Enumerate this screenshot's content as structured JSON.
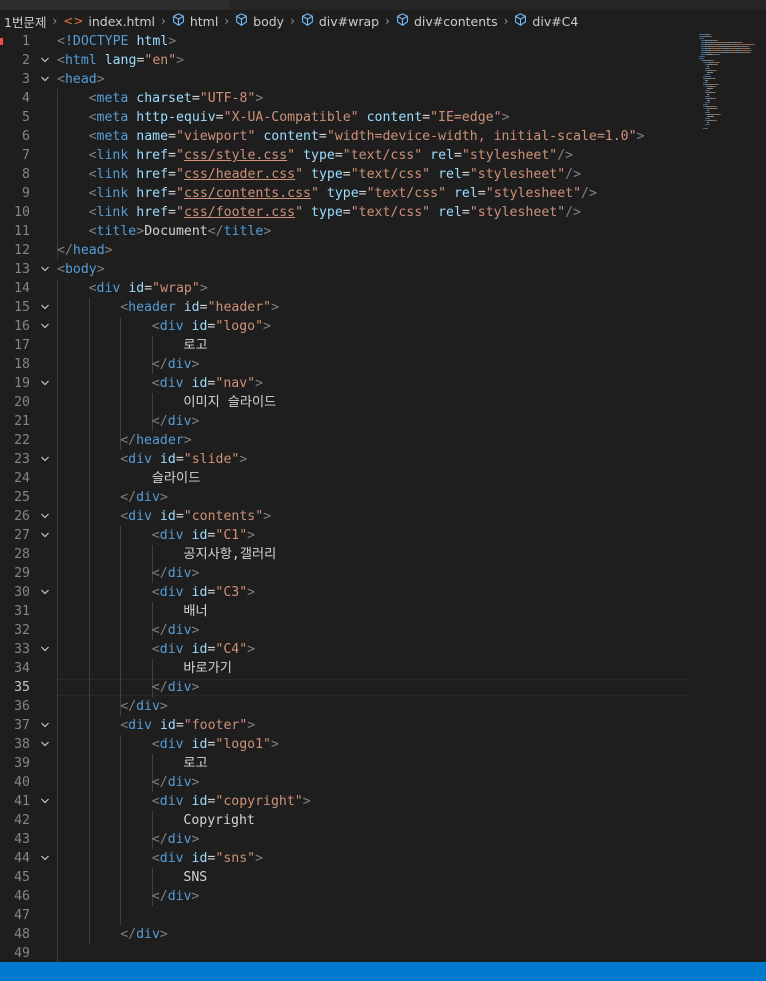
{
  "breadcrumb": [
    {
      "label": "1번문제",
      "icon": ""
    },
    {
      "label": "index.html",
      "icon": "html-file-icon"
    },
    {
      "label": "html",
      "icon": "element-cube-icon"
    },
    {
      "label": "body",
      "icon": "element-cube-icon"
    },
    {
      "label": "div#wrap",
      "icon": "element-cube-icon"
    },
    {
      "label": "div#contents",
      "icon": "element-cube-icon"
    },
    {
      "label": "div#C4",
      "icon": "element-cube-icon"
    }
  ],
  "active_line": 35,
  "colors": {
    "tag": "#569cd6",
    "attr": "#9cdcfe",
    "string": "#ce9178",
    "punct": "#808080",
    "text": "#d4d4d4",
    "status_bar": "#007acc"
  },
  "lines": [
    {
      "n": 1,
      "indent": 0,
      "fold": false,
      "tokens": [
        [
          "p",
          "<"
        ],
        [
          "t",
          "!DOCTYPE"
        ],
        [
          "x",
          " "
        ],
        [
          "a",
          "html"
        ],
        [
          "p",
          ">"
        ]
      ]
    },
    {
      "n": 2,
      "indent": 0,
      "fold": true,
      "tokens": [
        [
          "p",
          "<"
        ],
        [
          "t",
          "html"
        ],
        [
          "x",
          " "
        ],
        [
          "a",
          "lang"
        ],
        [
          "x",
          "="
        ],
        [
          "s",
          "\"en\""
        ],
        [
          "p",
          ">"
        ]
      ]
    },
    {
      "n": 3,
      "indent": 0,
      "fold": true,
      "tokens": [
        [
          "p",
          "<"
        ],
        [
          "t",
          "head"
        ],
        [
          "p",
          ">"
        ]
      ]
    },
    {
      "n": 4,
      "indent": 1,
      "fold": false,
      "tokens": [
        [
          "p",
          "<"
        ],
        [
          "t",
          "meta"
        ],
        [
          "x",
          " "
        ],
        [
          "a",
          "charset"
        ],
        [
          "x",
          "="
        ],
        [
          "s",
          "\"UTF-8\""
        ],
        [
          "p",
          ">"
        ]
      ]
    },
    {
      "n": 5,
      "indent": 1,
      "fold": false,
      "tokens": [
        [
          "p",
          "<"
        ],
        [
          "t",
          "meta"
        ],
        [
          "x",
          " "
        ],
        [
          "a",
          "http-equiv"
        ],
        [
          "x",
          "="
        ],
        [
          "s",
          "\"X-UA-Compatible\""
        ],
        [
          "x",
          " "
        ],
        [
          "a",
          "content"
        ],
        [
          "x",
          "="
        ],
        [
          "s",
          "\"IE=edge\""
        ],
        [
          "p",
          ">"
        ]
      ]
    },
    {
      "n": 6,
      "indent": 1,
      "fold": false,
      "tokens": [
        [
          "p",
          "<"
        ],
        [
          "t",
          "meta"
        ],
        [
          "x",
          " "
        ],
        [
          "a",
          "name"
        ],
        [
          "x",
          "="
        ],
        [
          "s",
          "\"viewport\""
        ],
        [
          "x",
          " "
        ],
        [
          "a",
          "content"
        ],
        [
          "x",
          "="
        ],
        [
          "s",
          "\"width=device-width, initial-scale=1.0\""
        ],
        [
          "p",
          ">"
        ]
      ]
    },
    {
      "n": 7,
      "indent": 1,
      "fold": false,
      "tokens": [
        [
          "p",
          "<"
        ],
        [
          "t",
          "link"
        ],
        [
          "x",
          " "
        ],
        [
          "a",
          "href"
        ],
        [
          "x",
          "="
        ],
        [
          "s",
          "\""
        ],
        [
          "su",
          "css/style.css"
        ],
        [
          "s",
          "\""
        ],
        [
          "x",
          " "
        ],
        [
          "a",
          "type"
        ],
        [
          "x",
          "="
        ],
        [
          "s",
          "\"text/css\""
        ],
        [
          "x",
          " "
        ],
        [
          "a",
          "rel"
        ],
        [
          "x",
          "="
        ],
        [
          "s",
          "\"stylesheet\""
        ],
        [
          "p",
          "/>"
        ]
      ]
    },
    {
      "n": 8,
      "indent": 1,
      "fold": false,
      "tokens": [
        [
          "p",
          "<"
        ],
        [
          "t",
          "link"
        ],
        [
          "x",
          " "
        ],
        [
          "a",
          "href"
        ],
        [
          "x",
          "="
        ],
        [
          "s",
          "\""
        ],
        [
          "su",
          "css/header.css"
        ],
        [
          "s",
          "\""
        ],
        [
          "x",
          " "
        ],
        [
          "a",
          "type"
        ],
        [
          "x",
          "="
        ],
        [
          "s",
          "\"text/css\""
        ],
        [
          "x",
          " "
        ],
        [
          "a",
          "rel"
        ],
        [
          "x",
          "="
        ],
        [
          "s",
          "\"stylesheet\""
        ],
        [
          "p",
          "/>"
        ]
      ]
    },
    {
      "n": 9,
      "indent": 1,
      "fold": false,
      "tokens": [
        [
          "p",
          "<"
        ],
        [
          "t",
          "link"
        ],
        [
          "x",
          " "
        ],
        [
          "a",
          "href"
        ],
        [
          "x",
          "="
        ],
        [
          "s",
          "\""
        ],
        [
          "su",
          "css/contents.css"
        ],
        [
          "s",
          "\""
        ],
        [
          "x",
          " "
        ],
        [
          "a",
          "type"
        ],
        [
          "x",
          "="
        ],
        [
          "s",
          "\"text/css\""
        ],
        [
          "x",
          " "
        ],
        [
          "a",
          "rel"
        ],
        [
          "x",
          "="
        ],
        [
          "s",
          "\"stylesheet\""
        ],
        [
          "p",
          "/>"
        ]
      ]
    },
    {
      "n": 10,
      "indent": 1,
      "fold": false,
      "tokens": [
        [
          "p",
          "<"
        ],
        [
          "t",
          "link"
        ],
        [
          "x",
          " "
        ],
        [
          "a",
          "href"
        ],
        [
          "x",
          "="
        ],
        [
          "s",
          "\""
        ],
        [
          "su",
          "css/footer.css"
        ],
        [
          "s",
          "\""
        ],
        [
          "x",
          " "
        ],
        [
          "a",
          "type"
        ],
        [
          "x",
          "="
        ],
        [
          "s",
          "\"text/css\""
        ],
        [
          "x",
          " "
        ],
        [
          "a",
          "rel"
        ],
        [
          "x",
          "="
        ],
        [
          "s",
          "\"stylesheet\""
        ],
        [
          "p",
          "/>"
        ]
      ]
    },
    {
      "n": 11,
      "indent": 1,
      "fold": false,
      "tokens": [
        [
          "p",
          "<"
        ],
        [
          "t",
          "title"
        ],
        [
          "p",
          ">"
        ],
        [
          "x",
          "Document"
        ],
        [
          "p",
          "</"
        ],
        [
          "t",
          "title"
        ],
        [
          "p",
          ">"
        ]
      ]
    },
    {
      "n": 12,
      "indent": 0,
      "fold": false,
      "tokens": [
        [
          "p",
          "</"
        ],
        [
          "t",
          "head"
        ],
        [
          "p",
          ">"
        ]
      ]
    },
    {
      "n": 13,
      "indent": 0,
      "fold": true,
      "tokens": [
        [
          "p",
          "<"
        ],
        [
          "t",
          "body"
        ],
        [
          "p",
          ">"
        ]
      ]
    },
    {
      "n": 14,
      "indent": 1,
      "fold": false,
      "tokens": [
        [
          "p",
          "<"
        ],
        [
          "t",
          "div"
        ],
        [
          "x",
          " "
        ],
        [
          "a",
          "id"
        ],
        [
          "x",
          "="
        ],
        [
          "s",
          "\"wrap\""
        ],
        [
          "p",
          ">"
        ]
      ]
    },
    {
      "n": 15,
      "indent": 2,
      "fold": true,
      "tokens": [
        [
          "p",
          "<"
        ],
        [
          "t",
          "header"
        ],
        [
          "x",
          " "
        ],
        [
          "a",
          "id"
        ],
        [
          "x",
          "="
        ],
        [
          "s",
          "\"header\""
        ],
        [
          "p",
          ">"
        ]
      ]
    },
    {
      "n": 16,
      "indent": 3,
      "fold": true,
      "tokens": [
        [
          "p",
          "<"
        ],
        [
          "t",
          "div"
        ],
        [
          "x",
          " "
        ],
        [
          "a",
          "id"
        ],
        [
          "x",
          "="
        ],
        [
          "s",
          "\"logo\""
        ],
        [
          "p",
          ">"
        ]
      ]
    },
    {
      "n": 17,
      "indent": 4,
      "fold": false,
      "tokens": [
        [
          "x",
          "로고"
        ]
      ]
    },
    {
      "n": 18,
      "indent": 3,
      "fold": false,
      "tokens": [
        [
          "p",
          "</"
        ],
        [
          "t",
          "div"
        ],
        [
          "p",
          ">"
        ]
      ]
    },
    {
      "n": 19,
      "indent": 3,
      "fold": true,
      "tokens": [
        [
          "p",
          "<"
        ],
        [
          "t",
          "div"
        ],
        [
          "x",
          " "
        ],
        [
          "a",
          "id"
        ],
        [
          "x",
          "="
        ],
        [
          "s",
          "\"nav\""
        ],
        [
          "p",
          ">"
        ]
      ]
    },
    {
      "n": 20,
      "indent": 4,
      "fold": false,
      "tokens": [
        [
          "x",
          "이미지 슬라이드"
        ]
      ]
    },
    {
      "n": 21,
      "indent": 3,
      "fold": false,
      "tokens": [
        [
          "p",
          "</"
        ],
        [
          "t",
          "div"
        ],
        [
          "p",
          ">"
        ]
      ]
    },
    {
      "n": 22,
      "indent": 2,
      "fold": false,
      "tokens": [
        [
          "p",
          "</"
        ],
        [
          "t",
          "header"
        ],
        [
          "p",
          ">"
        ]
      ]
    },
    {
      "n": 23,
      "indent": 2,
      "fold": true,
      "tokens": [
        [
          "p",
          "<"
        ],
        [
          "t",
          "div"
        ],
        [
          "x",
          " "
        ],
        [
          "a",
          "id"
        ],
        [
          "x",
          "="
        ],
        [
          "s",
          "\"slide\""
        ],
        [
          "p",
          ">"
        ]
      ]
    },
    {
      "n": 24,
      "indent": 3,
      "fold": false,
      "tokens": [
        [
          "x",
          "슬라이드"
        ]
      ]
    },
    {
      "n": 25,
      "indent": 2,
      "fold": false,
      "tokens": [
        [
          "p",
          "</"
        ],
        [
          "t",
          "div"
        ],
        [
          "p",
          ">"
        ]
      ]
    },
    {
      "n": 26,
      "indent": 2,
      "fold": true,
      "tokens": [
        [
          "p",
          "<"
        ],
        [
          "t",
          "div"
        ],
        [
          "x",
          " "
        ],
        [
          "a",
          "id"
        ],
        [
          "x",
          "="
        ],
        [
          "s",
          "\"contents\""
        ],
        [
          "p",
          ">"
        ]
      ]
    },
    {
      "n": 27,
      "indent": 3,
      "fold": true,
      "tokens": [
        [
          "p",
          "<"
        ],
        [
          "t",
          "div"
        ],
        [
          "x",
          " "
        ],
        [
          "a",
          "id"
        ],
        [
          "x",
          "="
        ],
        [
          "s",
          "\"C1\""
        ],
        [
          "p",
          ">"
        ]
      ]
    },
    {
      "n": 28,
      "indent": 4,
      "fold": false,
      "tokens": [
        [
          "x",
          "공지사항,갤러리"
        ]
      ]
    },
    {
      "n": 29,
      "indent": 3,
      "fold": false,
      "tokens": [
        [
          "p",
          "</"
        ],
        [
          "t",
          "div"
        ],
        [
          "p",
          ">"
        ]
      ]
    },
    {
      "n": 30,
      "indent": 3,
      "fold": true,
      "tokens": [
        [
          "p",
          "<"
        ],
        [
          "t",
          "div"
        ],
        [
          "x",
          " "
        ],
        [
          "a",
          "id"
        ],
        [
          "x",
          "="
        ],
        [
          "s",
          "\"C3\""
        ],
        [
          "p",
          ">"
        ]
      ]
    },
    {
      "n": 31,
      "indent": 4,
      "fold": false,
      "tokens": [
        [
          "x",
          "배너"
        ]
      ]
    },
    {
      "n": 32,
      "indent": 3,
      "fold": false,
      "tokens": [
        [
          "p",
          "</"
        ],
        [
          "t",
          "div"
        ],
        [
          "p",
          ">"
        ]
      ]
    },
    {
      "n": 33,
      "indent": 3,
      "fold": true,
      "tokens": [
        [
          "p",
          "<"
        ],
        [
          "t",
          "div"
        ],
        [
          "x",
          " "
        ],
        [
          "a",
          "id"
        ],
        [
          "x",
          "="
        ],
        [
          "s",
          "\"C4\""
        ],
        [
          "p",
          ">"
        ]
      ]
    },
    {
      "n": 34,
      "indent": 4,
      "fold": false,
      "tokens": [
        [
          "x",
          "바로가기"
        ]
      ]
    },
    {
      "n": 35,
      "indent": 3,
      "fold": false,
      "tokens": [
        [
          "p",
          "</"
        ],
        [
          "t",
          "div"
        ],
        [
          "p",
          ">"
        ]
      ]
    },
    {
      "n": 36,
      "indent": 2,
      "fold": false,
      "tokens": [
        [
          "p",
          "</"
        ],
        [
          "t",
          "div"
        ],
        [
          "p",
          ">"
        ]
      ]
    },
    {
      "n": 37,
      "indent": 2,
      "fold": true,
      "tokens": [
        [
          "p",
          "<"
        ],
        [
          "t",
          "div"
        ],
        [
          "x",
          " "
        ],
        [
          "a",
          "id"
        ],
        [
          "x",
          "="
        ],
        [
          "s",
          "\"footer\""
        ],
        [
          "p",
          ">"
        ]
      ]
    },
    {
      "n": 38,
      "indent": 3,
      "fold": true,
      "tokens": [
        [
          "p",
          "<"
        ],
        [
          "t",
          "div"
        ],
        [
          "x",
          " "
        ],
        [
          "a",
          "id"
        ],
        [
          "x",
          "="
        ],
        [
          "s",
          "\"logo1\""
        ],
        [
          "p",
          ">"
        ]
      ]
    },
    {
      "n": 39,
      "indent": 4,
      "fold": false,
      "tokens": [
        [
          "x",
          "로고"
        ]
      ]
    },
    {
      "n": 40,
      "indent": 3,
      "fold": false,
      "tokens": [
        [
          "p",
          "</"
        ],
        [
          "t",
          "div"
        ],
        [
          "p",
          ">"
        ]
      ]
    },
    {
      "n": 41,
      "indent": 3,
      "fold": true,
      "tokens": [
        [
          "p",
          "<"
        ],
        [
          "t",
          "div"
        ],
        [
          "x",
          " "
        ],
        [
          "a",
          "id"
        ],
        [
          "x",
          "="
        ],
        [
          "s",
          "\"copyright\""
        ],
        [
          "p",
          ">"
        ]
      ]
    },
    {
      "n": 42,
      "indent": 4,
      "fold": false,
      "tokens": [
        [
          "x",
          "Copyright"
        ]
      ]
    },
    {
      "n": 43,
      "indent": 3,
      "fold": false,
      "tokens": [
        [
          "p",
          "</"
        ],
        [
          "t",
          "div"
        ],
        [
          "p",
          ">"
        ]
      ]
    },
    {
      "n": 44,
      "indent": 3,
      "fold": true,
      "tokens": [
        [
          "p",
          "<"
        ],
        [
          "t",
          "div"
        ],
        [
          "x",
          " "
        ],
        [
          "a",
          "id"
        ],
        [
          "x",
          "="
        ],
        [
          "s",
          "\"sns\""
        ],
        [
          "p",
          ">"
        ]
      ]
    },
    {
      "n": 45,
      "indent": 4,
      "fold": false,
      "tokens": [
        [
          "x",
          "SNS"
        ]
      ]
    },
    {
      "n": 46,
      "indent": 3,
      "fold": false,
      "tokens": [
        [
          "p",
          "</"
        ],
        [
          "t",
          "div"
        ],
        [
          "p",
          ">"
        ]
      ]
    },
    {
      "n": 47,
      "indent": 2,
      "fold": false,
      "tokens": []
    },
    {
      "n": 48,
      "indent": 2,
      "fold": false,
      "tokens": [
        [
          "p",
          "</"
        ],
        [
          "t",
          "div"
        ],
        [
          "p",
          ">"
        ]
      ]
    },
    {
      "n": 49,
      "indent": 0,
      "fold": false,
      "tokens": []
    }
  ]
}
